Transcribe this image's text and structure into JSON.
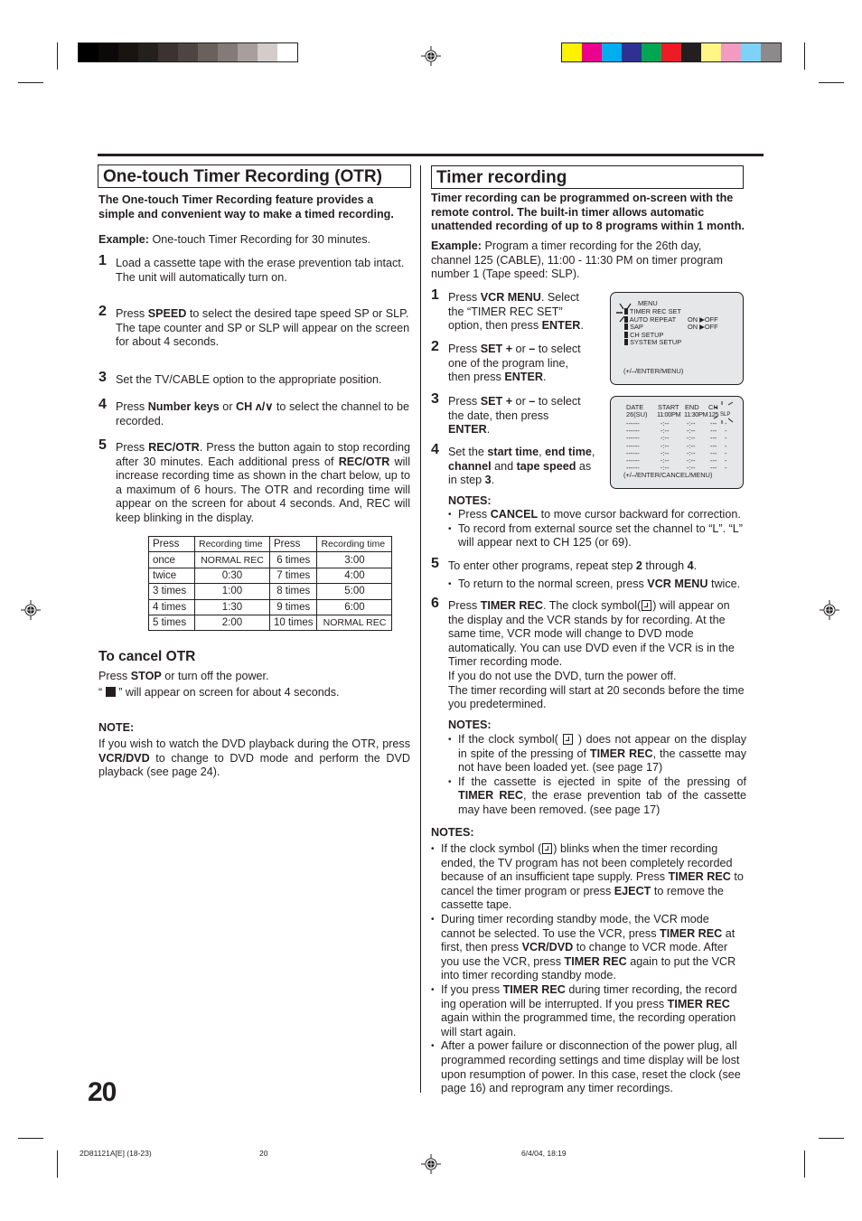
{
  "print_marks": {
    "gray_swatches": [
      "#000000",
      "#0b0a09",
      "#171412",
      "#24201d",
      "#3c3330",
      "#4e4542",
      "#6a605c",
      "#847a77",
      "#a89f9d",
      "#d3cccb",
      "#ffffff"
    ],
    "color_swatches": [
      "#fff200",
      "#ec008c",
      "#00aeef",
      "#2e3192",
      "#00a651",
      "#ed1c24",
      "#231f20",
      "#fff685",
      "#f49ac1",
      "#7dd3f7",
      "#8c8a8b"
    ]
  },
  "left": {
    "title": "One-touch Timer Recording (OTR)",
    "intro": "The One-touch Timer Recording feature provides a simple and convenient way to make a timed recording.",
    "example_label": "Example:",
    "example_text": " One-touch Timer Recording for 30 minutes.",
    "steps": [
      {
        "num": "1",
        "text": "Load a cassette tape with the erase prevention tab intact.",
        "text2": "The unit will automatically turn on."
      },
      {
        "num": "2",
        "pre": "Press ",
        "bold": "SPEED",
        "post": " to select the desired tape speed SP or SLP.",
        "text2": "The tape counter and SP or SLP will appear on the screen for about 4 seconds."
      },
      {
        "num": "3",
        "text": "Set the TV/CABLE option to the appropriate position."
      },
      {
        "num": "4",
        "pre": "Press ",
        "bold": "Number keys",
        "mid": " or ",
        "bold2": "CH ʌ/∨",
        "post": " to select the channel to be recorded."
      },
      {
        "num": "5",
        "pre": "Press ",
        "bold": "REC/OTR",
        "mid": ". Press the button again to stop recording after 30 minutes. Each additional press of ",
        "bold2": "REC/OTR",
        "post": " will increase recording time as shown in the chart below, up to a maximum of 6 hours. The OTR and recording time will appear on the screen for about 4 seconds. And, REC will keep blinking in the display."
      }
    ],
    "table": {
      "headers": [
        "Press",
        "Recording time",
        "Press",
        "Recording time"
      ],
      "rows": [
        [
          "once",
          "NORMAL REC",
          "6 times",
          "3:00"
        ],
        [
          "twice",
          "0:30",
          "7 times",
          "4:00"
        ],
        [
          "3 times",
          "1:00",
          "8 times",
          "5:00"
        ],
        [
          "4 times",
          "1:30",
          "9 times",
          "6:00"
        ],
        [
          "5 times",
          "2:00",
          "10 times",
          "NORMAL REC"
        ]
      ]
    },
    "cancel": {
      "heading": "To cancel OTR",
      "line1_pre": "Press ",
      "line1_bold": "STOP",
      "line1_post": " or turn off the power.",
      "line2_open": "“ ",
      "line2_post": " ” will appear on screen for about 4 seconds."
    },
    "note": {
      "heading": "NOTE:",
      "pre": "If you wish to watch the DVD playback during the OTR, press ",
      "bold": "VCR/DVD",
      "post": " to change to DVD mode and perform the DVD playback (see page 24)."
    }
  },
  "right": {
    "title": "Timer recording",
    "intro": "Timer recording can be programmed on-screen with the remote control. The built-in timer allows automatic unattended recording of up to 8 programs within 1 month.",
    "example_label": "Example:",
    "example_text": " Program a timer recording for the 26th day, channel 125 (CABLE), 11:00 - 11:30 PM on timer program number 1 (Tape speed: SLP).",
    "steps": [
      {
        "num": "1",
        "pre": "Press ",
        "bold": "VCR MENU",
        "mid": ". Select the “TIMER REC SET” option, then press ",
        "bold2": "ENTER",
        "post": "."
      },
      {
        "num": "2",
        "pre": "Press ",
        "bold": "SET +",
        "mid": " or ",
        "bold2": "–",
        "mid2": " to select one of the program line, then press ",
        "bold3": "ENTER",
        "post": "."
      },
      {
        "num": "3",
        "pre": "Press ",
        "bold": "SET +",
        "mid": " or ",
        "bold2": "–",
        "mid2": " to select the date, then press ",
        "bold3": "ENTER",
        "post": "."
      },
      {
        "num": "4",
        "pre": "Set the ",
        "bold": "start time",
        "mid": ", ",
        "bold2": "end time",
        "mid2": ", ",
        "bold3": "channel",
        "mid3": " and ",
        "bold4": "tape speed",
        "mid4": " as in step ",
        "bold5": "3",
        "post": "."
      },
      {
        "num": "5",
        "pre": "To enter other programs, repeat step ",
        "bold": "2",
        "mid": " through ",
        "bold2": "4",
        "post": "."
      },
      {
        "num": "6",
        "pre": "Press ",
        "bold": "TIMER REC",
        "post": ". The clock symbol(",
        "post2": ") will appear on the display and the VCR stands by for recording. At the same time, VCR mode will change to DVD mode automatically. You can use DVD even if the VCR is in the Timer recording mode.",
        "text2": "If you do not use the DVD, turn the power off.",
        "text3": "The timer recording will start at 20 seconds before the time you predetermined."
      }
    ],
    "notes_a": {
      "heading": "NOTES:",
      "items": [
        {
          "pre": "Press ",
          "bold": "CANCEL",
          "post": " to move cursor backward for correction."
        },
        {
          "text": "To record from external source set the channel to “L”. “L” will appear next to CH 125 (or 69)."
        }
      ]
    },
    "step5_bullet": {
      "pre": "To return to the normal screen, press ",
      "bold": "VCR MENU",
      "post": " twice."
    },
    "notes_b": {
      "heading": "NOTES:",
      "items": [
        {
          "pre": "If the clock symbol( ",
          "mid": " ) does not appear on the display in spite of the pressing of ",
          "bold": "TIMER REC",
          "post": ", the cassette may not have been loaded yet. (see page 17)"
        },
        {
          "pre": "If the cassette is ejected in spite of the pressing of ",
          "bold": "TIMER REC",
          "post": ", the erase prevention tab of the cassette may have been  removed. (see page 17)"
        }
      ]
    },
    "notes_c": {
      "heading": "NOTES:",
      "items": [
        {
          "pre": "If the clock symbol (",
          "mid": ") blinks when the timer recording ended, the TV program has not been completely recorded because of an insufficient tape supply. Press ",
          "bold": "TIMER REC",
          "mid2": " to cancel the timer program or press ",
          "bold2": "EJECT",
          "post": " to remove the cassette tape."
        },
        {
          "pre": "During timer recording standby mode, the VCR mode cannot be selected. To use the VCR, press ",
          "bold": "TIMER REC",
          "mid": " at first, then press ",
          "bold2": "VCR/DVD",
          "mid2": " to change to VCR mode. After you use the VCR, press ",
          "bold3": "TIMER REC",
          "post": " again to put the VCR into timer recording standby mode."
        },
        {
          "pre": "If you press ",
          "bold": "TIMER REC",
          "mid": " during timer recording, the record ing operation will be interrupted. If you press ",
          "bold2": "TIMER REC",
          "post": " again within the programmed time, the recording operation will start again."
        },
        {
          "text": "After a power failure or disconnection of the power plug, all programmed recording settings and time display will be lost upon resumption of power. In this case, reset the clock (see page 16) and reprogram any timer recordings."
        }
      ]
    },
    "osd_menu": {
      "title": "MENU",
      "items": [
        "TIMER REC SET",
        "AUTO REPEAT",
        "SAP",
        "CH SETUP",
        "SYSTEM SETUP"
      ],
      "values": {
        "auto_repeat": "ON ▶OFF",
        "sap": "ON ▶OFF"
      },
      "footer": "(+/–/ENTER/MENU)"
    },
    "osd_timer": {
      "headers": [
        "DATE",
        "START",
        "END",
        "CH"
      ],
      "first_row": {
        "date": "26(SU)",
        "start": "11:00PM",
        "end": "11:30PM",
        "ch": "125",
        "speed": "SLP"
      },
      "empty_row": {
        "date": "------",
        "start": "-:--",
        "end": "-:--",
        "ch": "---",
        "speed": "-"
      },
      "empty_rows_count": 7,
      "footer": "(+/–/ENTER/CANCEL/MENU)"
    }
  },
  "page_number": "20",
  "footer": {
    "code": "2D81121A[E] (18-23)",
    "page": "20",
    "date": "6/4/04, 18:19"
  }
}
